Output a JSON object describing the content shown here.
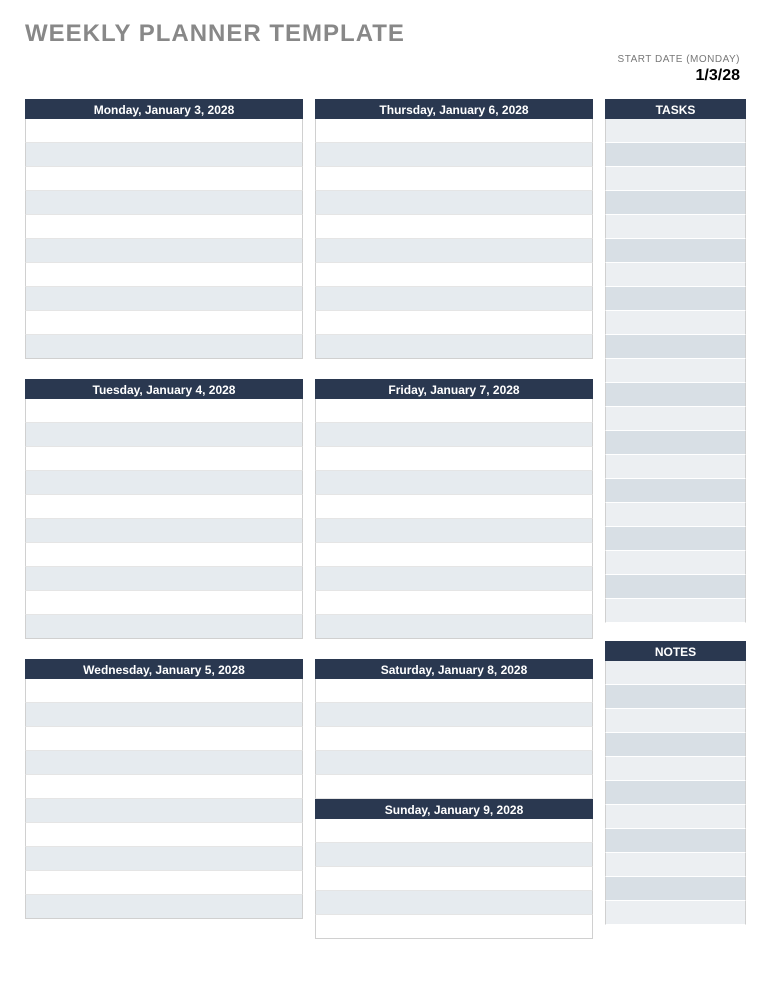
{
  "title": "WEEKLY PLANNER TEMPLATE",
  "start_date_label": "START DATE (MONDAY)",
  "start_date_value": "1/3/28",
  "col1": {
    "day1": {
      "header": "Monday, January 3, 2028",
      "rows": 10
    },
    "day2": {
      "header": "Tuesday, January 4, 2028",
      "rows": 10
    },
    "day3": {
      "header": "Wednesday, January 5, 2028",
      "rows": 10
    }
  },
  "col2": {
    "day1": {
      "header": "Thursday, January 6, 2028",
      "rows": 10
    },
    "day2": {
      "header": "Friday, January 7, 2028",
      "rows": 10
    },
    "day3a": {
      "header": "Saturday, January 8, 2028",
      "rows": 5
    },
    "day3b": {
      "header": "Sunday, January 9, 2028",
      "rows": 5
    }
  },
  "side": {
    "tasks": {
      "header": "TASKS",
      "rows": 21
    },
    "notes": {
      "header": "NOTES",
      "rows": 11
    }
  }
}
